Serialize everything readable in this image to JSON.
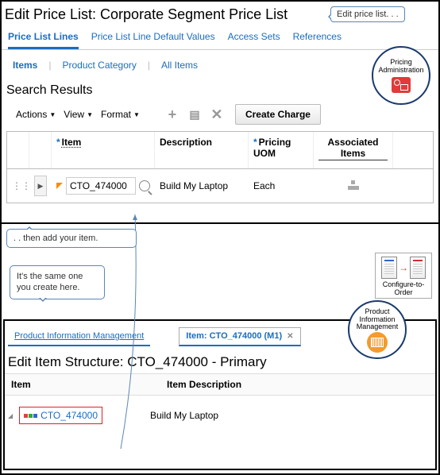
{
  "page_title": "Edit Price List: Corporate Segment Price List",
  "callouts": {
    "edit": "Edit price list. . .",
    "add_item": ". . then add your item.",
    "same": "It's the same one you create here."
  },
  "main_tabs": [
    "Price List Lines",
    "Price List Line Default Values",
    "Access Sets",
    "References"
  ],
  "sub_tabs": [
    "Items",
    "Product Category",
    "All Items"
  ],
  "search_results_heading": "Search Results",
  "toolbar": {
    "actions": "Actions",
    "view": "View",
    "format": "Format",
    "create_charge": "Create Charge"
  },
  "grid": {
    "headers": {
      "item": "Item",
      "description": "Description",
      "uom": "Pricing UOM",
      "assoc": "Associated Items"
    },
    "row": {
      "item": "CTO_474000",
      "description": "Build My Laptop",
      "uom": "Each"
    }
  },
  "badge_pricing": "Pricing Administration",
  "badge_pim": "Product Information Management",
  "cto_chip": "Configure-to-Order",
  "bottom": {
    "tab_pim": "Product Information Management",
    "tab_item": "Item: CTO_474000 (M1)",
    "title": "Edit Item Structure: CTO_474000 - Primary",
    "col_item": "Item",
    "col_desc": "Item Description",
    "row_item": "CTO_474000",
    "row_desc": "Build My Laptop"
  }
}
